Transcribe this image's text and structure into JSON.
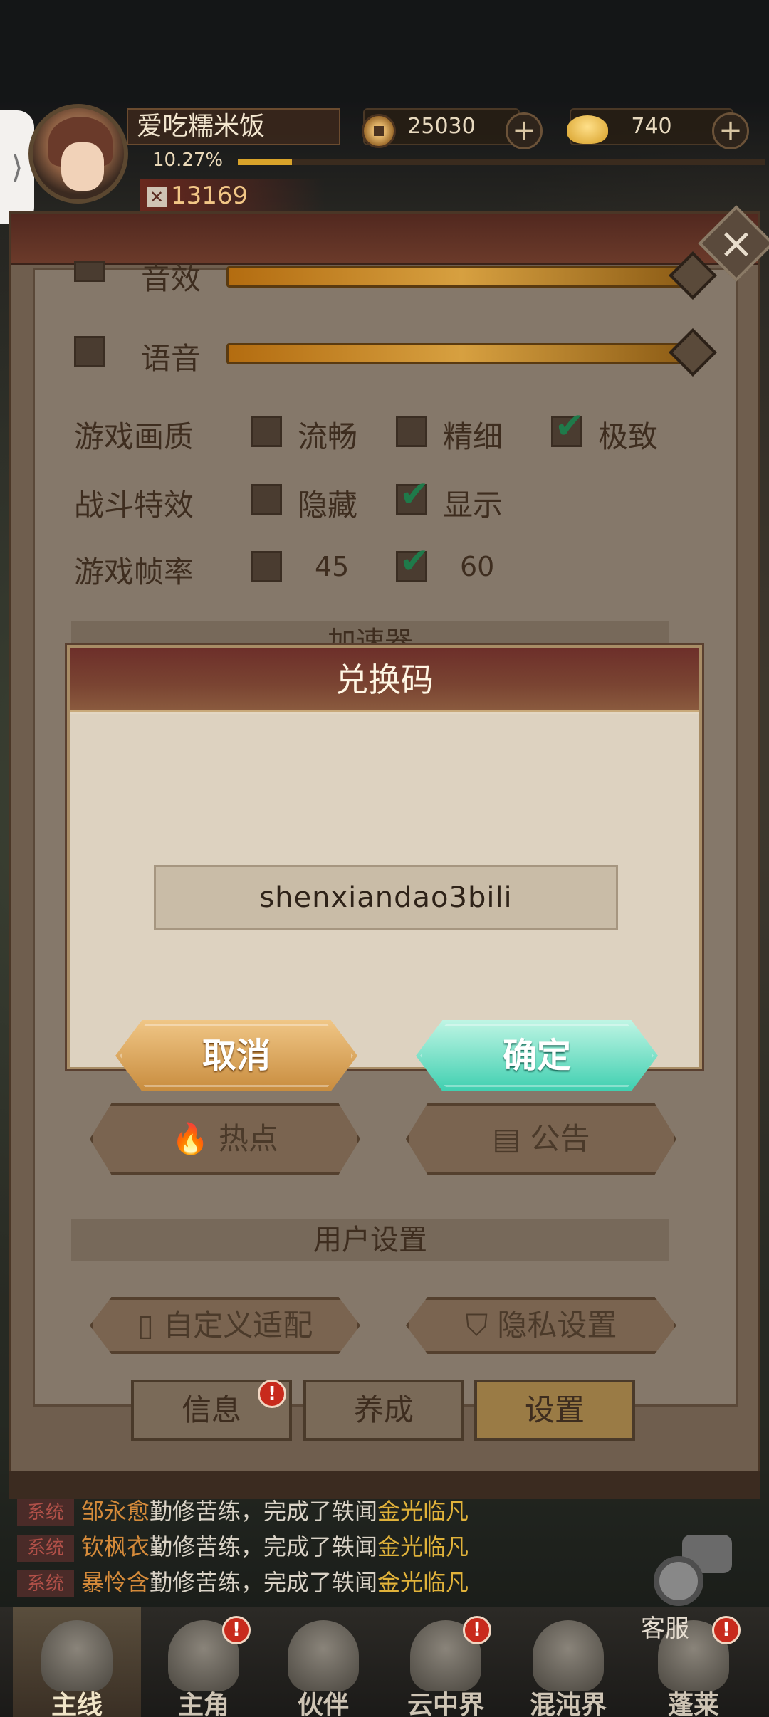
{
  "player": {
    "name": "爱吃糯米饭",
    "level_progress": "10.27%",
    "level_progress_fraction": 0.1027,
    "power": "13169"
  },
  "currency": {
    "coins": "25030",
    "ingots": "740"
  },
  "settings": {
    "sound_effects_label": "音效",
    "voice_label": "语音",
    "quality": {
      "label": "游戏画质",
      "options": [
        "流畅",
        "精细",
        "极致"
      ],
      "selected": "极致"
    },
    "battle_fx": {
      "label": "战斗特效",
      "options": [
        "隐藏",
        "显示"
      ],
      "selected": "显示"
    },
    "framerate": {
      "label": "游戏帧率",
      "options": [
        "45",
        "60"
      ],
      "selected": "60"
    },
    "accelerator_label": "加速器",
    "hot_button": "热点",
    "notice_button": "公告",
    "user_settings_title": "用户设置",
    "custom_adapt_button": "自定义适配",
    "privacy_button": "隐私设置"
  },
  "panel_tabs": [
    "信息",
    "养成",
    "设置"
  ],
  "modal": {
    "title": "兑换码",
    "code_value": "shenxiandao3bili",
    "cancel_label": "取消",
    "confirm_label": "确定"
  },
  "chat": {
    "tag": "系统",
    "lines": [
      {
        "name": "邹永愈",
        "action": "勤修苦练，完成了轶闻",
        "item": "金光临凡"
      },
      {
        "name": "钦枫衣",
        "action": "勤修苦练，完成了轶闻",
        "item": "金光临凡"
      },
      {
        "name": "暴怜含",
        "action": "勤修苦练，完成了轶闻",
        "item": "金光临凡"
      }
    ]
  },
  "customer_service_label": "客服",
  "nav": [
    "主线",
    "主角",
    "伙伴",
    "云中界",
    "混沌界",
    "蓬莱"
  ],
  "colors": {
    "accent_gold": "#d9a32a",
    "confirm_teal": "#3fcfb0",
    "cancel_orange": "#c88c3e",
    "badge_red": "#c82a1c"
  }
}
